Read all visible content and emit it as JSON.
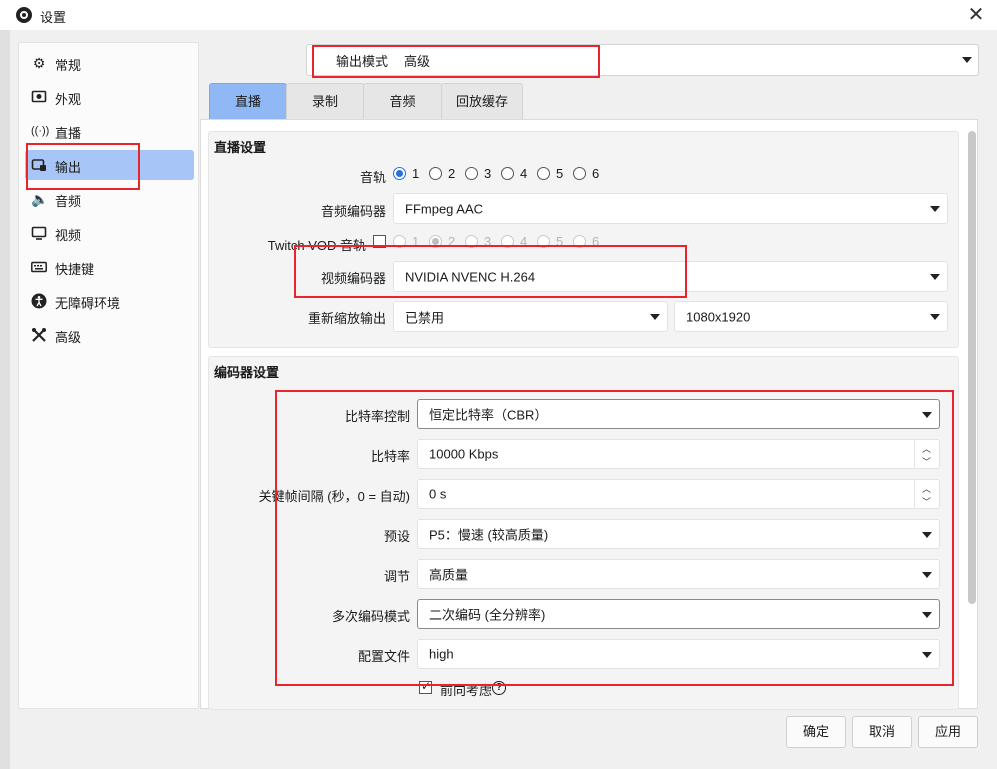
{
  "window": {
    "title": "设置",
    "close_label": "✕"
  },
  "sidebar": {
    "items": [
      {
        "label": "常规",
        "icon": "gear-icon"
      },
      {
        "label": "外观",
        "icon": "appearance-icon"
      },
      {
        "label": "直播",
        "icon": "broadcast-icon"
      },
      {
        "label": "输出",
        "icon": "output-icon",
        "selected": true
      },
      {
        "label": "音频",
        "icon": "speaker-icon"
      },
      {
        "label": "视频",
        "icon": "monitor-icon"
      },
      {
        "label": "快捷键",
        "icon": "keyboard-icon"
      },
      {
        "label": "无障碍环境",
        "icon": "accessibility-icon"
      },
      {
        "label": "高级",
        "icon": "tools-icon"
      }
    ]
  },
  "output_mode": {
    "label": "输出模式",
    "value": "高级"
  },
  "tabs": [
    {
      "label": "直播",
      "active": true
    },
    {
      "label": "录制"
    },
    {
      "label": "音频"
    },
    {
      "label": "回放缓存"
    }
  ],
  "stream_settings": {
    "title": "直播设置",
    "audio_track": {
      "label": "音轨",
      "options": [
        "1",
        "2",
        "3",
        "4",
        "5",
        "6"
      ],
      "selected": "1"
    },
    "audio_encoder": {
      "label": "音频编码器",
      "value": "FFmpeg AAC"
    },
    "twitch_vod": {
      "label": "Twitch VOD 音轨",
      "checked": false,
      "options": [
        "1",
        "2",
        "3",
        "4",
        "5",
        "6"
      ],
      "selected": "2"
    },
    "video_encoder": {
      "label": "视频编码器",
      "value": "NVIDIA NVENC H.264"
    },
    "rescale": {
      "label": "重新缩放输出",
      "value": "已禁用",
      "resolution": "1080x1920"
    }
  },
  "encoder_settings": {
    "title": "编码器设置",
    "rate_control": {
      "label": "比特率控制",
      "value": "恒定比特率（CBR）"
    },
    "bitrate": {
      "label": "比特率",
      "value": "10000 Kbps"
    },
    "keyframe": {
      "label": "关键帧间隔 (秒，0 = 自动)",
      "value": "0 s"
    },
    "preset": {
      "label": "预设",
      "value": "P5：慢速 (较高质量)"
    },
    "tuning": {
      "label": "调节",
      "value": "高质量"
    },
    "multipass": {
      "label": "多次编码模式",
      "value": "二次编码 (全分辨率)"
    },
    "profile": {
      "label": "配置文件",
      "value": "high"
    },
    "lookahead": {
      "label": "前向考虑",
      "checked": true,
      "help": "?"
    }
  },
  "buttons": {
    "ok": "确定",
    "cancel": "取消",
    "apply": "应用"
  },
  "spin": {
    "up": "︿",
    "down": "﹀"
  },
  "colors": {
    "selected_nav": "#a7c6f7",
    "active_tab": "#8fb8f5",
    "annotation": "#e8242c"
  }
}
